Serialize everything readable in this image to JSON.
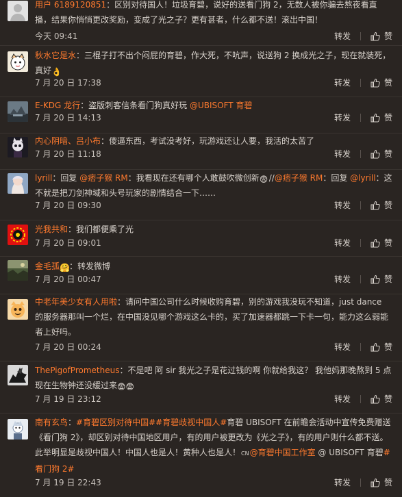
{
  "actions": {
    "repost": "转发",
    "like": "赞"
  },
  "comments": [
    {
      "username": "用户 6189120851",
      "text": "：区别对待国人！垃圾育碧，说好的送看门狗 2，无数人被你骗去熬夜看直播，结果你悄悄更改奖励，变成了光之子？更有甚者，什么都不送！滚出中国！",
      "time": "今天 09:41"
    },
    {
      "username": "秋水它是水",
      "text": "：三棍子打不出个闷屁的育碧，作大死，不吭声，说送狗 2 换成光之子，现在就装死，真好",
      "emoji": "👌",
      "time": "7 月 20 日 17:38"
    },
    {
      "username": "E-KDG 龙行",
      "text": "：盗版刺客信条看门狗真好玩 ",
      "mention": "@UBISOFT 育碧",
      "time": "7 月 20 日 14:13"
    },
    {
      "username": "内心阴暗、吕小布",
      "text": "：傻逼东西，考试没考好，玩游戏还让人要，我活的太苦了",
      "time": "7 月 20 日 11:18"
    },
    {
      "username": "lyrill",
      "p1": "：回复 ",
      "m1": "@痞子猴 RM",
      "p2": "：我看现在还有哪个人敢鼓吹微创新",
      "emoji": "😨",
      "p3": "//",
      "m2": "@痞子猴 RM",
      "p4": "：回复 ",
      "m3": "@lyrill",
      "p5": "：这不就是把刀剑神域和头号玩家的剧情结合一下……",
      "time": "7 月 20 日 09:30"
    },
    {
      "username": "光我共和",
      "text": "：我们都便乘了光",
      "time": "7 月 20 日 09:01"
    },
    {
      "username": "金毛孤",
      "emoji": "🤗",
      "text": "：转发微博",
      "time": "7 月 20 日 00:47"
    },
    {
      "username": "中老年美少女有人用啦",
      "text": "：请问中国公司什么时候收购育碧，别的游戏我没玩不知道，just dance 的服务器那叫一个烂，在中国没见哪个游戏这么卡的，买了加速器都跳一下卡一句，能力这么弱能者上好吗。",
      "time": "7 月 20 日 00:24"
    },
    {
      "username": "ThePigofPrometheus",
      "text": "：不是吧 阿 sir 我光之子是花过钱的啊 你就给我这？ 我他妈那晚熬到 5 点 现在生物钟还没缓过来",
      "emoji": "😨😨",
      "time": "7 月 19 日 23:12"
    },
    {
      "username": "南有玄鸟",
      "p1": "：",
      "t1": "#育碧区别对待中国#",
      "t2": "#育碧歧视中国人#",
      "p2": "育碧 UBISOFT 在前瞻会活动中宣传免费赠送《看门狗 2》，却区别对待中国地区用户，有的用户被更改为《光之子》，有的用户则什么都不送。此举明显是歧视中国人！中国人也是人！黄种人也是人！",
      "cn": "CN",
      "m1": "@育碧中国工作室",
      "p3": " @ UBISOFT 育碧",
      "t3": "#看门狗 2#",
      "time": "7 月 19 日 22:43"
    }
  ]
}
